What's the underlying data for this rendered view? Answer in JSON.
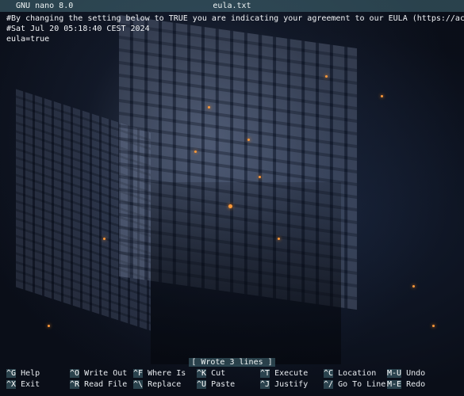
{
  "titlebar": {
    "app": "GNU nano 8.0",
    "filename": "eula.txt"
  },
  "editor": {
    "lines": [
      "#By changing the setting below to TRUE you are indicating your agreement to our EULA (https://account.moja>",
      "#Sat Jul 20 05:18:40 CEST 2024",
      "eula=true"
    ]
  },
  "status": {
    "message": "[ Wrote 3 lines ]"
  },
  "shortcuts": {
    "row1": [
      {
        "key": "^G",
        "label": "Help"
      },
      {
        "key": "^O",
        "label": "Write Out"
      },
      {
        "key": "^F",
        "label": "Where Is"
      },
      {
        "key": "^K",
        "label": "Cut"
      },
      {
        "key": "^T",
        "label": "Execute"
      },
      {
        "key": "^C",
        "label": "Location"
      },
      {
        "key": "M-U",
        "label": "Undo"
      }
    ],
    "row2": [
      {
        "key": "^X",
        "label": "Exit"
      },
      {
        "key": "^R",
        "label": "Read File"
      },
      {
        "key": "^\\",
        "label": "Replace"
      },
      {
        "key": "^U",
        "label": "Paste"
      },
      {
        "key": "^J",
        "label": "Justify"
      },
      {
        "key": "^/",
        "label": "Go To Line"
      },
      {
        "key": "M-E",
        "label": "Redo"
      }
    ]
  },
  "colors": {
    "bar": "#466e78",
    "background": "#0a0f1a",
    "spark": "#ff9a3a"
  }
}
